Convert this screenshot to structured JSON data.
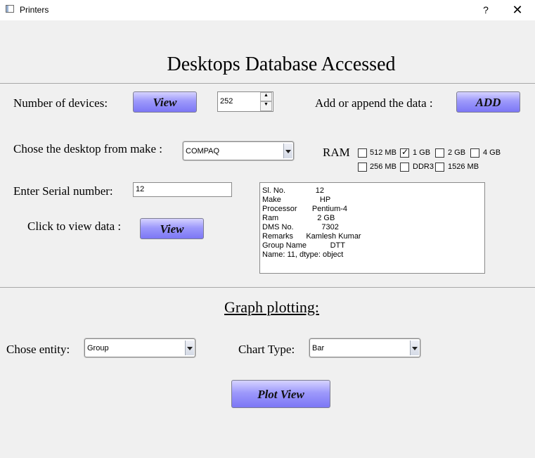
{
  "window": {
    "title": "Printers",
    "help": "?",
    "close": "✕"
  },
  "heading": "Desktops Database Accessed",
  "devices": {
    "label": "Number of devices:",
    "view_button": "View",
    "count": "252"
  },
  "append": {
    "label": "Add or append  the data :",
    "add_button": "ADD"
  },
  "make": {
    "label": "Chose the desktop  from make :",
    "selected": "COMPAQ"
  },
  "ram": {
    "label": "RAM",
    "options": [
      {
        "label": "512 MB",
        "checked": false
      },
      {
        "label": "1 GB",
        "checked": true
      },
      {
        "label": "2 GB",
        "checked": false
      },
      {
        "label": "4 GB",
        "checked": false
      },
      {
        "label": "256 MB",
        "checked": false
      },
      {
        "label": "DDR3",
        "checked": false
      },
      {
        "label": "1526 MB",
        "checked": false
      }
    ]
  },
  "serial": {
    "label": "Enter Serial number:",
    "value": "12"
  },
  "view_data": {
    "label": "Click to view data :",
    "button": "View"
  },
  "output_lines": [
    "Sl. No.              12",
    "Make                  HP",
    "Processor       Pentium-4",
    "Ram                  2 GB",
    "DMS No.             7302",
    "Remarks      Kamlesh Kumar",
    "Group Name           DTT",
    "Name: 11, dtype: object"
  ],
  "graph": {
    "heading": "Graph plotting:",
    "entity_label": "Chose entity:",
    "entity_value": "Group",
    "chart_type_label": "Chart Type:",
    "chart_type_value": "Bar",
    "plot_button": "Plot View"
  }
}
